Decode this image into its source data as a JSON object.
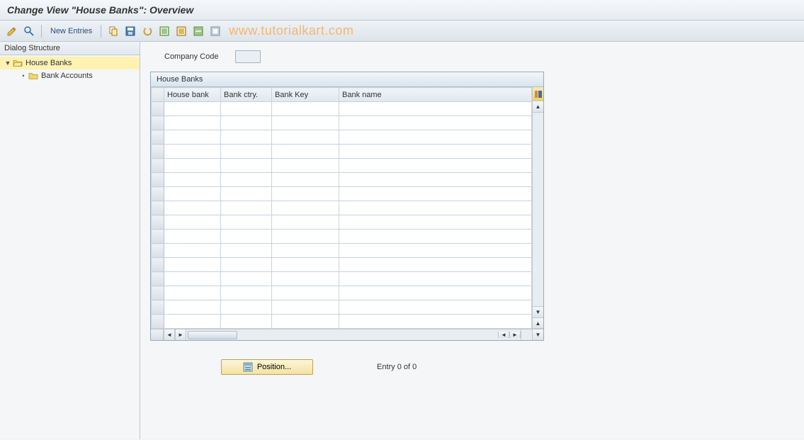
{
  "title": "Change View \"House Banks\": Overview",
  "toolbar": {
    "new_entries_label": "New Entries"
  },
  "watermark": "www.tutorialkart.com",
  "tree": {
    "header": "Dialog Structure",
    "items": [
      {
        "label": "House Banks",
        "selected": true,
        "level": 1,
        "open": true
      },
      {
        "label": "Bank Accounts",
        "selected": false,
        "level": 2,
        "open": false
      }
    ]
  },
  "company_code": {
    "label": "Company Code",
    "value": ""
  },
  "table": {
    "title": "House Banks",
    "columns": [
      "House bank",
      "Bank ctry.",
      "Bank Key",
      "Bank name"
    ],
    "row_count": 16
  },
  "position_button": "Position...",
  "entry_text": "Entry 0 of 0"
}
